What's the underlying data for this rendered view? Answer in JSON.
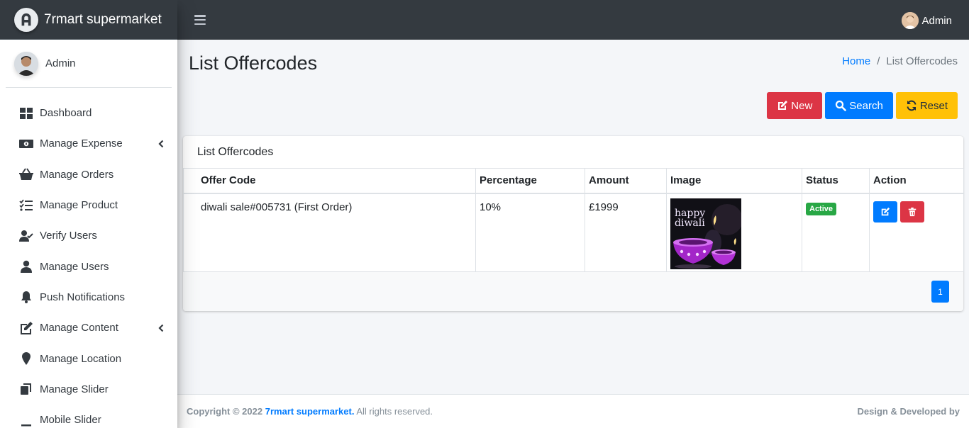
{
  "brand": {
    "name": "7rmart supermarket"
  },
  "user_panel": {
    "name": "Admin"
  },
  "topbar": {
    "user": "Admin"
  },
  "sidebar": {
    "items": [
      {
        "label": "Dashboard",
        "icon": "dashboard-icon",
        "has_caret": false
      },
      {
        "label": "Manage Expense",
        "icon": "money-bill-icon",
        "has_caret": true
      },
      {
        "label": "Manage Orders",
        "icon": "basket-icon",
        "has_caret": false
      },
      {
        "label": "Manage Product",
        "icon": "tasks-icon",
        "has_caret": false
      },
      {
        "label": "Verify Users",
        "icon": "user-check-icon",
        "has_caret": false
      },
      {
        "label": "Manage Users",
        "icon": "user-icon",
        "has_caret": false
      },
      {
        "label": "Push Notifications",
        "icon": "bell-icon",
        "has_caret": false
      },
      {
        "label": "Manage Content",
        "icon": "edit-icon",
        "has_caret": true
      },
      {
        "label": "Manage Location",
        "icon": "map-marker-icon",
        "has_caret": false
      },
      {
        "label": "Manage Slider",
        "icon": "clone-icon",
        "has_caret": false
      },
      {
        "label": "Mobile Slider",
        "icon": "minus-icon",
        "has_caret": false
      }
    ]
  },
  "page": {
    "title": "List Offercodes",
    "breadcrumb": {
      "home": "Home",
      "current": "List Offercodes"
    }
  },
  "actions": {
    "new": "New",
    "search": "Search",
    "reset": "Reset"
  },
  "card": {
    "title": "List Offercodes",
    "columns": [
      "Offer Code",
      "Percentage",
      "Amount",
      "Image",
      "Status",
      "Action"
    ],
    "rows": [
      {
        "offer_code": "diwali sale#005731 (First Order)",
        "percentage": "10%",
        "amount": "£1999",
        "image_text": "happy diwali",
        "status": "Active"
      }
    ],
    "pagination": {
      "current_page": "1"
    }
  },
  "footer": {
    "copyright_prefix": "Copyright © 2022",
    "brand_link": "7rmart supermarket.",
    "rights": "All rights reserved.",
    "right_text": "Design & Developed by"
  },
  "colors": {
    "topbar": "#343a40",
    "primary": "#007bff",
    "danger": "#dc3545",
    "warning": "#ffc107",
    "success": "#28a745"
  }
}
